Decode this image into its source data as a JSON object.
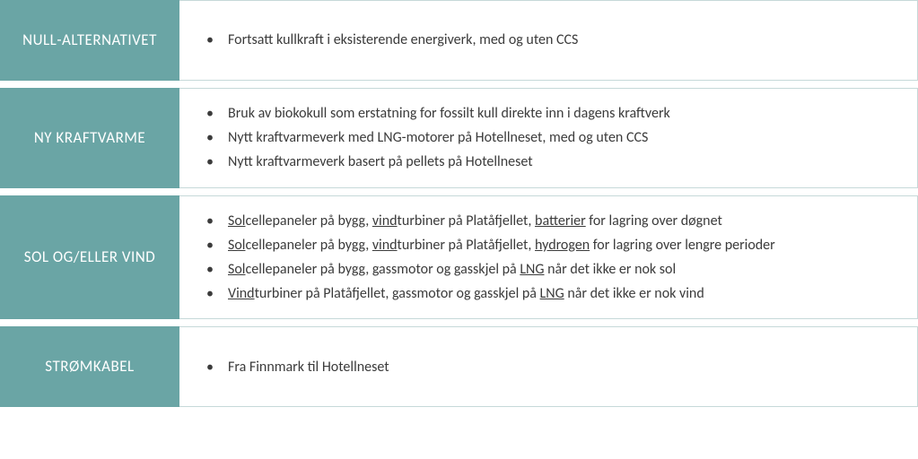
{
  "rows": [
    {
      "label": "NULL-ALTERNATIVET",
      "items": [
        {
          "parts": [
            {
              "t": "Fortsatt kullkraft i eksisterende energiverk, med og uten CCS"
            }
          ]
        }
      ]
    },
    {
      "label": "NY KRAFTVARME",
      "items": [
        {
          "parts": [
            {
              "t": "Bruk av biokokull som erstatning for fossilt kull direkte inn i dagens kraftverk"
            }
          ]
        },
        {
          "parts": [
            {
              "t": "Nytt kraftvarmeverk med LNG-motorer på Hotellneset, med og uten CCS"
            }
          ]
        },
        {
          "parts": [
            {
              "t": "Nytt kraftvarmeverk basert på pellets på Hotellneset"
            }
          ]
        }
      ]
    },
    {
      "label": "SOL OG/ELLER VIND",
      "items": [
        {
          "parts": [
            {
              "t": "Sol",
              "u": true
            },
            {
              "t": "cellepaneler på bygg, "
            },
            {
              "t": "vind",
              "u": true
            },
            {
              "t": "turbiner på Platåfjellet, "
            },
            {
              "t": "batterier",
              "u": true
            },
            {
              "t": " for lagring over døgnet"
            }
          ]
        },
        {
          "parts": [
            {
              "t": "Sol",
              "u": true
            },
            {
              "t": "cellepaneler på bygg, "
            },
            {
              "t": "vind",
              "u": true
            },
            {
              "t": "turbiner på Platåfjellet, "
            },
            {
              "t": "hydrogen",
              "u": true
            },
            {
              "t": " for lagring over lengre perioder"
            }
          ]
        },
        {
          "parts": [
            {
              "t": "Sol",
              "u": true
            },
            {
              "t": "cellepaneler på bygg, gassmotor og gasskjel på "
            },
            {
              "t": "LNG",
              "u": true
            },
            {
              "t": " når det ikke er nok sol"
            }
          ]
        },
        {
          "parts": [
            {
              "t": "Vind",
              "u": true
            },
            {
              "t": "turbiner på Platåfjellet, gassmotor og gasskjel på "
            },
            {
              "t": "LNG",
              "u": true
            },
            {
              "t": " når det ikke er nok vind"
            }
          ]
        }
      ]
    },
    {
      "label": "STRØMKABEL",
      "items": [
        {
          "parts": [
            {
              "t": "Fra Finnmark til Hotellneset"
            }
          ]
        }
      ]
    }
  ]
}
